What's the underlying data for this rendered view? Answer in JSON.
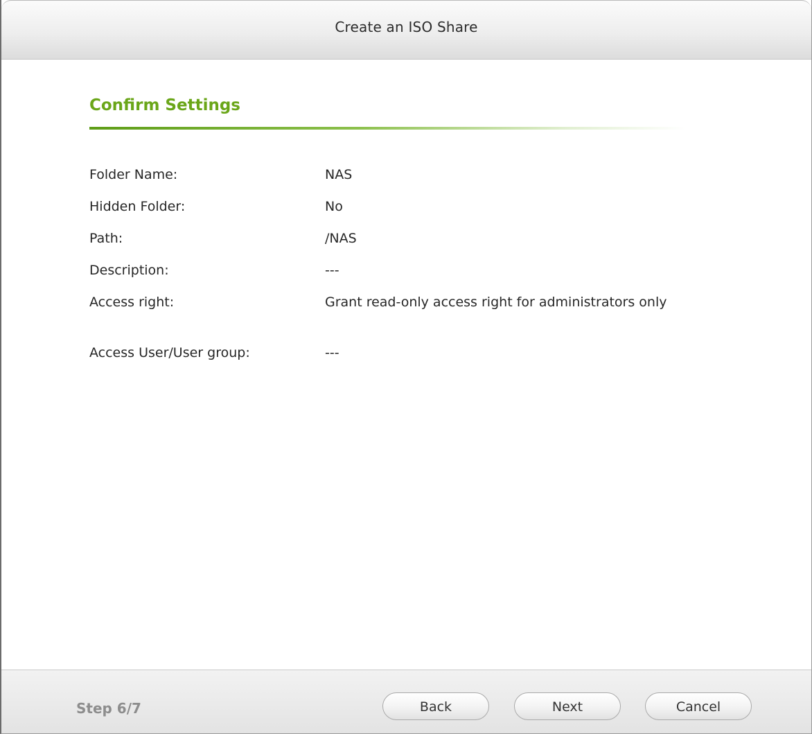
{
  "dialog": {
    "title": "Create an ISO Share"
  },
  "section": {
    "title": "Confirm Settings"
  },
  "settings": [
    {
      "label": "Folder Name:",
      "value": "NAS"
    },
    {
      "label": "Hidden Folder:",
      "value": "No"
    },
    {
      "label": "Path:",
      "value": "/NAS"
    },
    {
      "label": "Description:",
      "value": "---"
    },
    {
      "label": "Access right:",
      "value": "Grant read-only access right for administrators only"
    },
    {
      "label": "Access User/User group:",
      "value": "---"
    }
  ],
  "footer": {
    "step": "Step 6/7",
    "back_label": "Back",
    "next_label": "Next",
    "cancel_label": "Cancel"
  },
  "colors": {
    "accent": "#6aa619",
    "step_text": "#8d8d8d"
  }
}
